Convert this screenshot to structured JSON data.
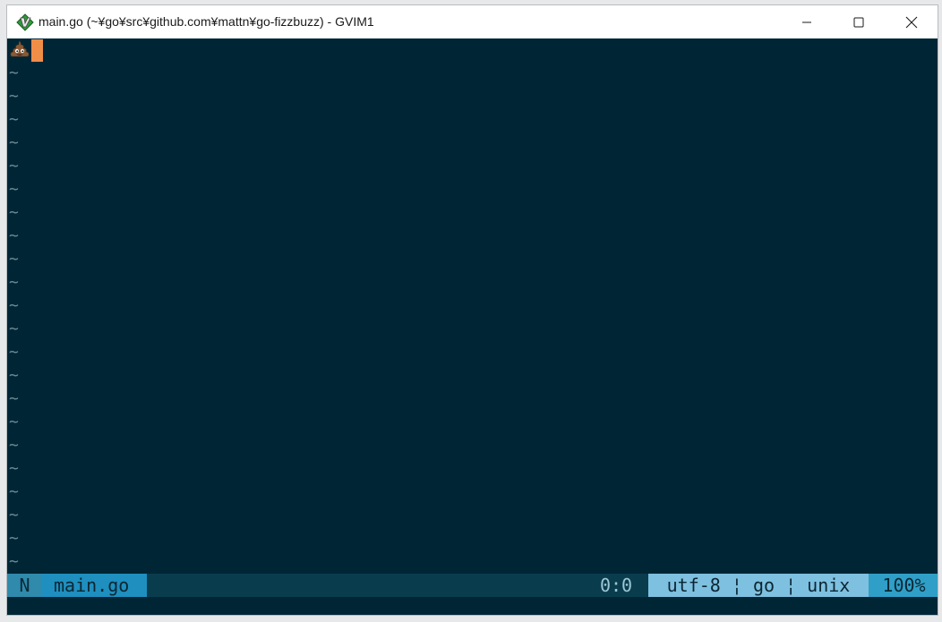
{
  "window": {
    "title": "main.go (~¥go¥src¥github.com¥mattn¥go-fizzbuzz) - GVIM1",
    "app_icon": "vim-icon",
    "controls": [
      "minimize-icon",
      "maximize-icon",
      "close-icon"
    ]
  },
  "editor": {
    "first_line_icon": "pile-of-poo-emoji",
    "empty_line_marker": "~",
    "empty_line_count": 22,
    "background_color": "#002635",
    "cursor_color": "#f08e48"
  },
  "statusline": {
    "mode": "N",
    "filename": "main.go",
    "position": "0:0",
    "file_info": "utf-8 ¦ go ¦ unix",
    "percent": "100%"
  }
}
